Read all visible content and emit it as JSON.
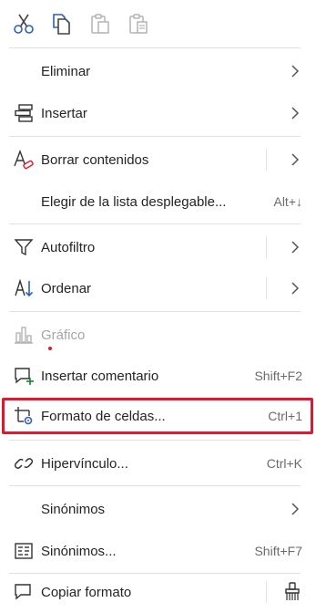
{
  "toolbar": {
    "buttons": [
      {
        "icon": "scissors-icon",
        "enabled": true
      },
      {
        "icon": "copy-icon",
        "enabled": true
      },
      {
        "icon": "paste-icon",
        "enabled": false
      },
      {
        "icon": "paste-special-icon",
        "enabled": false
      }
    ]
  },
  "items": {
    "eliminar": {
      "label": "Eliminar"
    },
    "insertar": {
      "label": "Insertar"
    },
    "borrar": {
      "label": "Borrar contenidos"
    },
    "elegir": {
      "label": "Elegir de la lista desplegable...",
      "shortcut": "Alt+↓"
    },
    "autofiltro": {
      "label": "Autofiltro"
    },
    "ordenar": {
      "label": "Ordenar"
    },
    "grafico": {
      "label": "Gráfico",
      "enabled": false
    },
    "comentario": {
      "label": "Insertar comentario",
      "shortcut": "Shift+F2"
    },
    "formato": {
      "label": "Formato de celdas...",
      "shortcut": "Ctrl+1",
      "highlighted": true
    },
    "hipervinculo": {
      "label": "Hipervínculo...",
      "shortcut": "Ctrl+K"
    },
    "sinonimos": {
      "label": "Sinónimos"
    },
    "sinonimos2": {
      "label": "Sinónimos...",
      "shortcut": "Shift+F7"
    },
    "copiar": {
      "label": "Copiar formato"
    }
  },
  "colors": {
    "accent": "#2b5fc7",
    "highlight_border": "#e0192f",
    "disabled": "#a6a6a6"
  }
}
